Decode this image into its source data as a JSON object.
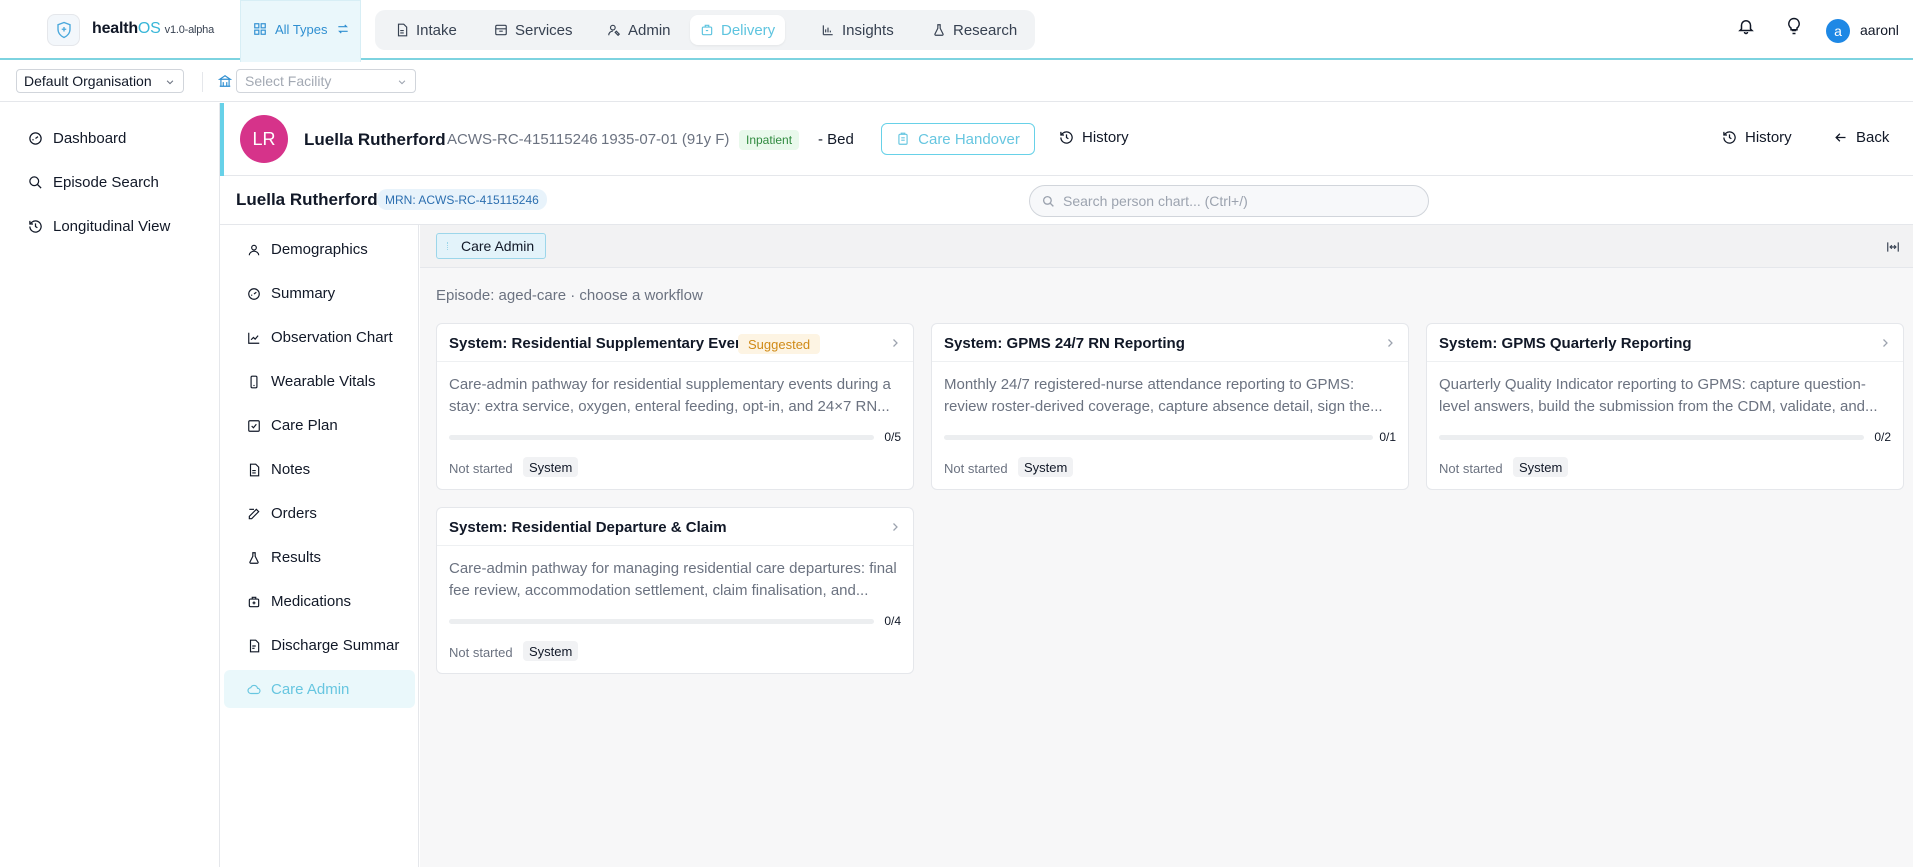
{
  "app": {
    "brand_main": "health",
    "brand_os": "OS",
    "version": "v1.0-alpha"
  },
  "topnav": {
    "all_types": "All Types",
    "items": [
      {
        "label": "Intake",
        "icon": "document-icon"
      },
      {
        "label": "Services",
        "icon": "box-icon"
      },
      {
        "label": "Admin",
        "icon": "admin-icon"
      },
      {
        "label": "Delivery",
        "icon": "delivery-icon",
        "active": true
      },
      {
        "label": "Insights",
        "icon": "bar-chart-icon"
      },
      {
        "label": "Research",
        "icon": "flask-icon"
      }
    ],
    "user_initial": "a",
    "username": "aaronl"
  },
  "orgbar": {
    "organisation": "Default Organisation",
    "facility_placeholder": "Select Facility"
  },
  "sidebar": {
    "items": [
      {
        "label": "Dashboard",
        "icon": "dashboard-icon"
      },
      {
        "label": "Episode Search",
        "icon": "search-icon"
      },
      {
        "label": "Longitudinal View",
        "icon": "history-icon"
      }
    ]
  },
  "patient": {
    "initials": "LR",
    "name": "Luella Rutherford",
    "mrn": "ACWS-RC-415115246",
    "dob": "1935-07-01 (91y F)",
    "status": "Inpatient",
    "bed": "- Bed",
    "handover_label": "Care Handover",
    "history_label": "History",
    "history2_label": "History",
    "back_label": "Back"
  },
  "chartbar": {
    "name": "Luella Rutherford",
    "mrn_badge": "MRN: ACWS-RC-415115246",
    "search_placeholder": "Search person chart... (Ctrl+/)"
  },
  "chartnav": {
    "items": [
      {
        "label": "Demographics",
        "icon": "person-icon"
      },
      {
        "label": "Summary",
        "icon": "gauge-icon"
      },
      {
        "label": "Observation Chart",
        "icon": "line-chart-icon"
      },
      {
        "label": "Wearable Vitals",
        "icon": "phone-icon"
      },
      {
        "label": "Care Plan",
        "icon": "checkbox-icon"
      },
      {
        "label": "Notes",
        "icon": "note-icon"
      },
      {
        "label": "Orders",
        "icon": "edit-icon"
      },
      {
        "label": "Results",
        "icon": "flask-icon"
      },
      {
        "label": "Medications",
        "icon": "medical-bag-icon"
      },
      {
        "label": "Discharge Summar",
        "icon": "discharge-icon"
      },
      {
        "label": "Care Admin",
        "icon": "cloud-icon",
        "active": true
      }
    ]
  },
  "main": {
    "tab_label": "Care Admin",
    "episode_text": "Episode: aged-care · choose a workflow",
    "cards": [
      {
        "title": "System: Residential Supplementary Events",
        "suggested": "Suggested",
        "description": "Care-admin pathway for residential supplementary events during a stay: extra service, oxygen, enteral feeding, opt-in, and 24×7 RN...",
        "progress_text": "0/5",
        "progress_fraction": 0,
        "status": "Not started",
        "tag": "System"
      },
      {
        "title": "System: GPMS 24/7 RN Reporting",
        "suggested": "",
        "description": "Monthly 24/7 registered-nurse attendance reporting to GPMS: review roster-derived coverage, capture absence detail, sign the...",
        "progress_text": "0/1",
        "progress_fraction": 0,
        "status": "Not started",
        "tag": "System"
      },
      {
        "title": "System: GPMS Quarterly Reporting",
        "suggested": "",
        "description": "Quarterly Quality Indicator reporting to GPMS: capture question-level answers, build the submission from the CDM, validate, and...",
        "progress_text": "0/2",
        "progress_fraction": 0,
        "status": "Not started",
        "tag": "System"
      },
      {
        "title": "System: Residential Departure & Claim",
        "suggested": "",
        "description": "Care-admin pathway for managing residential care departures: final fee review, accommodation settlement, claim finalisation, and...",
        "progress_text": "0/4",
        "progress_fraction": 0,
        "status": "Not started",
        "tag": "System"
      }
    ]
  },
  "colors": {
    "accent": "#67d1e8",
    "avatar_patient": "#d6338a",
    "avatar_user": "#1e88e5",
    "suggested": "#d08a16"
  }
}
